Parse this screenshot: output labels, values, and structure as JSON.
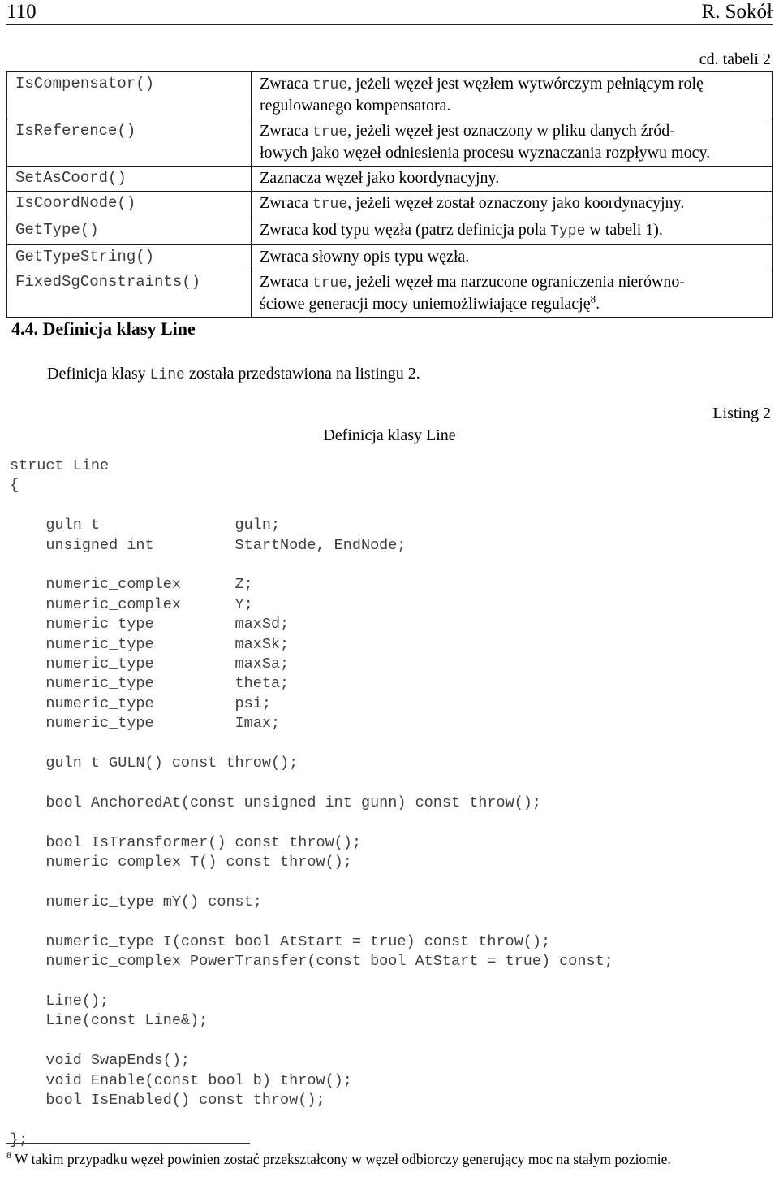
{
  "header": {
    "page_number": "110",
    "author": "R. Sokół"
  },
  "table": {
    "continuation_label": "cd. tabeli 2",
    "rows": [
      {
        "name": "IsCompensator()",
        "desc_lines": [
          {
            "segments": [
              {
                "text": "Zwraca ",
                "mono": false
              },
              {
                "text": "true",
                "mono": true
              },
              {
                "text": ", jeżeli węzeł jest węzłem wytwórczym pełniącym rolę",
                "mono": false
              }
            ]
          },
          {
            "segments": [
              {
                "text": "regulowanego kompensatora.",
                "mono": false
              }
            ]
          }
        ]
      },
      {
        "name": "IsReference()",
        "desc_lines": [
          {
            "segments": [
              {
                "text": "Zwraca ",
                "mono": false
              },
              {
                "text": "true",
                "mono": true
              },
              {
                "text": ", jeżeli węzeł jest oznaczony w pliku danych źród-",
                "mono": false
              }
            ]
          },
          {
            "segments": [
              {
                "text": "łowych jako węzeł odniesienia procesu wyznaczania rozpływu mocy.",
                "mono": false
              }
            ]
          }
        ]
      },
      {
        "name": "SetAsCoord()",
        "desc_lines": [
          {
            "segments": [
              {
                "text": "Zaznacza węzeł jako koordynacyjny.",
                "mono": false
              }
            ]
          }
        ]
      },
      {
        "name": "IsCoordNode()",
        "desc_lines": [
          {
            "segments": [
              {
                "text": "Zwraca ",
                "mono": false
              },
              {
                "text": "true",
                "mono": true
              },
              {
                "text": ", jeżeli węzeł został oznaczony jako koordynacyjny.",
                "mono": false
              }
            ]
          }
        ]
      },
      {
        "name": "GetType()",
        "desc_lines": [
          {
            "segments": [
              {
                "text": "Zwraca kod typu węzła (patrz definicja pola ",
                "mono": false
              },
              {
                "text": "Type",
                "mono": true
              },
              {
                "text": " w tabeli 1).",
                "mono": false
              }
            ]
          }
        ]
      },
      {
        "name": "GetTypeString()",
        "desc_lines": [
          {
            "segments": [
              {
                "text": "Zwraca słowny opis typu węzła.",
                "mono": false
              }
            ]
          }
        ]
      },
      {
        "name": "FixedSgConstraints()",
        "desc_lines": [
          {
            "segments": [
              {
                "text": "Zwraca ",
                "mono": false
              },
              {
                "text": "true",
                "mono": true
              },
              {
                "text": ", jeżeli węzeł ma narzucone ograniczenia nierówno-",
                "mono": false
              }
            ]
          },
          {
            "segments": [
              {
                "text": "ściowe generacji mocy uniemożliwiające regulację",
                "mono": false
              },
              {
                "text": "8",
                "sup": true
              },
              {
                "text": ".",
                "mono": false
              }
            ]
          }
        ]
      }
    ]
  },
  "section": {
    "heading": "4.4. Definicja klasy Line",
    "intro_before": "Definicja klasy ",
    "intro_mono": "Line",
    "intro_after": " została przedstawiona na listingu 2."
  },
  "listing": {
    "label": "Listing 2",
    "caption": "Definicja klasy Line",
    "code": "struct Line\n{\n\n    guln_t               guln;\n    unsigned int         StartNode, EndNode;\n\n    numeric_complex      Z;\n    numeric_complex      Y;\n    numeric_type         maxSd;\n    numeric_type         maxSk;\n    numeric_type         maxSa;\n    numeric_type         theta;\n    numeric_type         psi;\n    numeric_type         Imax;\n\n    guln_t GULN() const throw();\n\n    bool AnchoredAt(const unsigned int gunn) const throw();\n\n    bool IsTransformer() const throw();\n    numeric_complex T() const throw();\n\n    numeric_type mY() const;\n\n    numeric_type I(const bool AtStart = true) const throw();\n    numeric_complex PowerTransfer(const bool AtStart = true) const;\n\n    Line();\n    Line(const Line&);\n\n    void SwapEnds();\n    void Enable(const bool b) throw();\n    bool IsEnabled() const throw();\n\n};"
  },
  "footnote": {
    "marker": "8",
    "text": " W takim przypadku węzeł powinien zostać przekształcony w węzeł odbiorczy generujący moc na stałym poziomie."
  }
}
